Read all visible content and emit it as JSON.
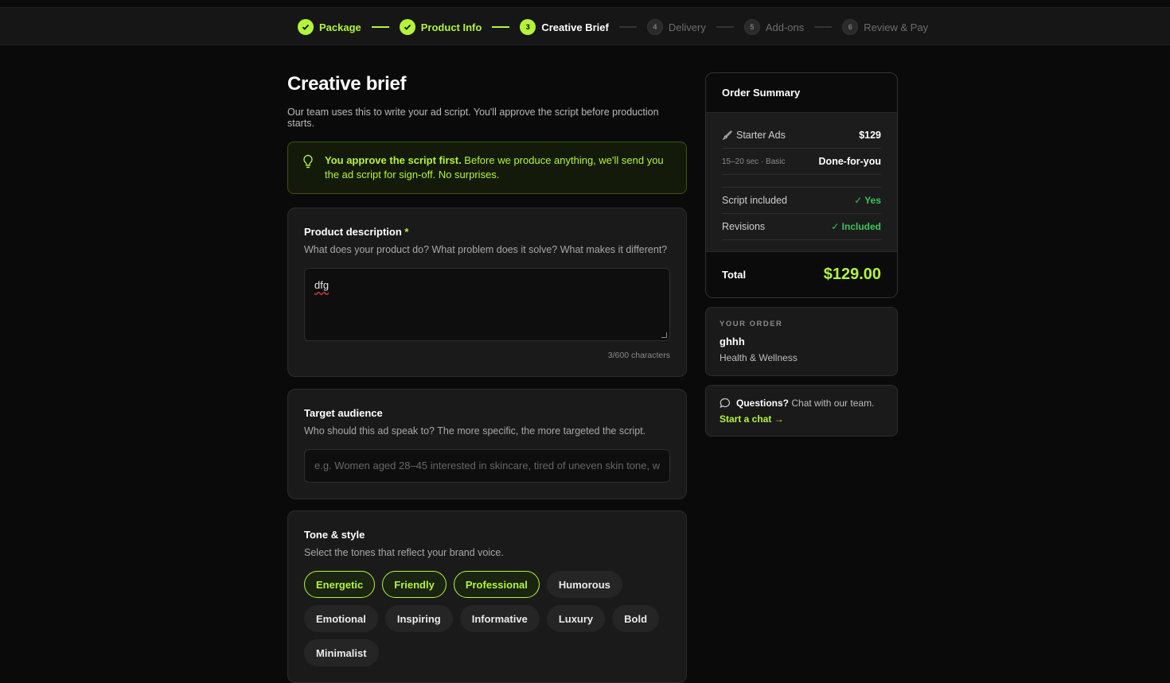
{
  "stepper": [
    {
      "num": "1",
      "label": "Package",
      "state": "done"
    },
    {
      "num": "2",
      "label": "Product Info",
      "state": "done"
    },
    {
      "num": "3",
      "label": "Creative Brief",
      "state": "current"
    },
    {
      "num": "4",
      "label": "Delivery",
      "state": "todo"
    },
    {
      "num": "5",
      "label": "Add-ons",
      "state": "todo"
    },
    {
      "num": "6",
      "label": "Review & Pay",
      "state": "todo"
    }
  ],
  "page": {
    "title": "Creative brief",
    "subtitle": "Our team uses this to write your ad script. You'll approve the script before production starts."
  },
  "tip": {
    "bold": "You approve the script first.",
    "text": " Before we produce anything, we'll send you the ad script for sign-off. No surprises."
  },
  "product_description": {
    "label": "Product description",
    "required_mark": "*",
    "help": "What does your product do? What problem does it solve? What makes it different?",
    "value": "dfg",
    "counter": "3/600 characters"
  },
  "target_audience": {
    "label": "Target audience",
    "help": "Who should this ad speak to? The more specific, the more targeted the script.",
    "placeholder": "e.g. Women aged 28–45 interested in skincare, tired of uneven skin tone, w"
  },
  "tone": {
    "label": "Tone & style",
    "help": "Select the tones that reflect your brand voice.",
    "options": [
      {
        "label": "Energetic",
        "selected": true
      },
      {
        "label": "Friendly",
        "selected": true
      },
      {
        "label": "Professional",
        "selected": true
      },
      {
        "label": "Humorous",
        "selected": false
      },
      {
        "label": "Emotional",
        "selected": false
      },
      {
        "label": "Inspiring",
        "selected": false
      },
      {
        "label": "Informative",
        "selected": false
      },
      {
        "label": "Luxury",
        "selected": false
      },
      {
        "label": "Bold",
        "selected": false
      },
      {
        "label": "Minimalist",
        "selected": false
      }
    ]
  },
  "summary": {
    "title": "Order Summary",
    "package_name": "Starter Ads",
    "package_price": "$129",
    "package_detail": "15–20 sec · Basic",
    "package_type": "Done-for-you",
    "script_label": "Script included",
    "script_value": "✓ Yes",
    "revisions_label": "Revisions",
    "revisions_value": "✓ Included",
    "total_label": "Total",
    "total_value": "$129.00"
  },
  "your_order": {
    "caption": "YOUR ORDER",
    "name": "ghhh",
    "category": "Health & Wellness"
  },
  "help": {
    "bold": "Questions?",
    "text": " Chat with our team.",
    "link": "Start a chat →"
  },
  "colors": {
    "accent": "#b4f538",
    "success": "#3ec55a",
    "background": "#0a0a0a"
  }
}
